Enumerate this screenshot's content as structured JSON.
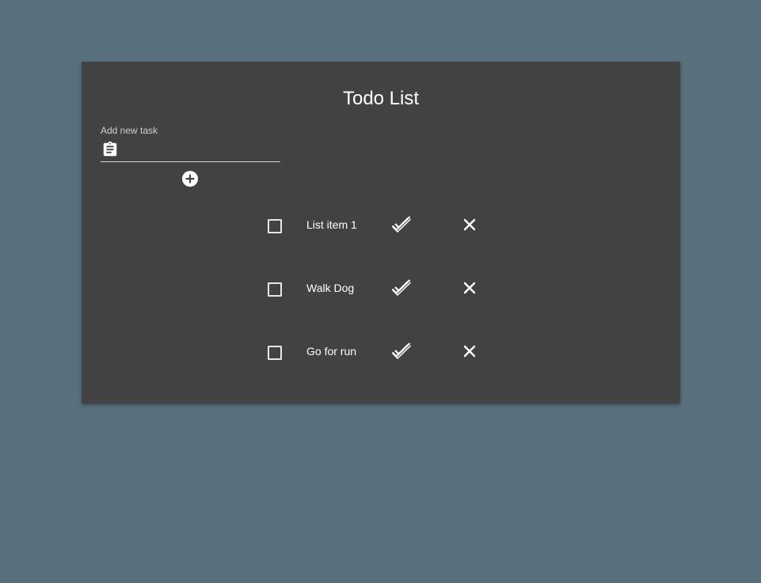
{
  "header": {
    "title": "Todo List"
  },
  "new_task": {
    "label": "Add new task",
    "value": "",
    "icon": "clipboard-icon",
    "add_icon": "add-circle-icon"
  },
  "todos": [
    {
      "text": "List item 1",
      "checked": false,
      "done_icon": "double-check-icon",
      "delete_icon": "close-icon"
    },
    {
      "text": "Walk Dog",
      "checked": false,
      "done_icon": "double-check-icon",
      "delete_icon": "close-icon"
    },
    {
      "text": "Go for run",
      "checked": false,
      "done_icon": "double-check-icon",
      "delete_icon": "close-icon"
    }
  ],
  "colors": {
    "page_background": "#586f7c",
    "card_background": "#424242",
    "text": "#ffffff",
    "label": "#cfcfcf"
  }
}
